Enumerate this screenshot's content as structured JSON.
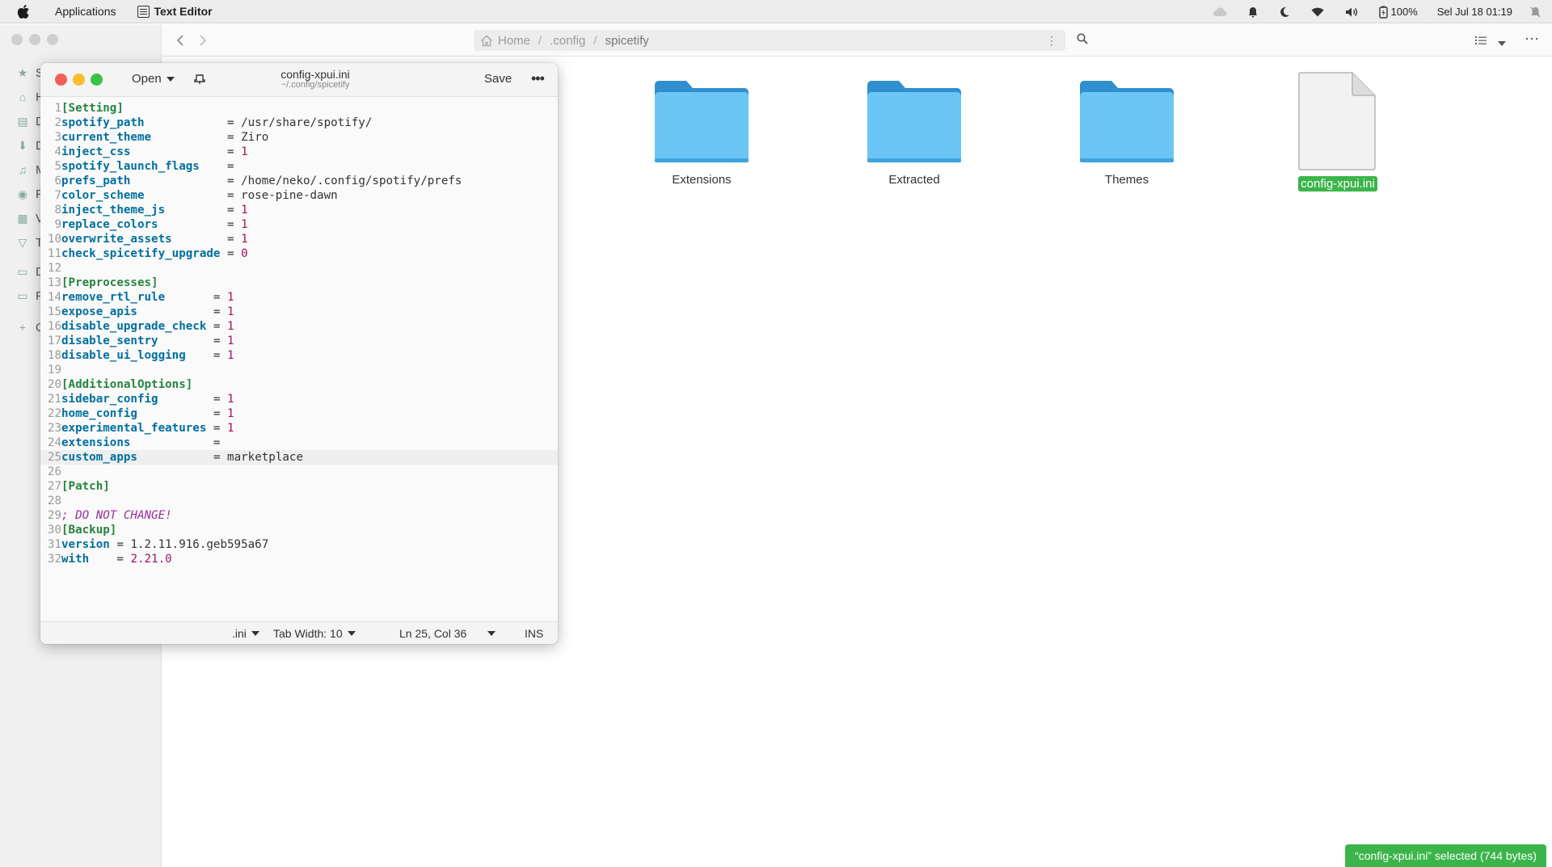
{
  "topbar": {
    "apple_icon": "apple-logo-icon",
    "applications": "Applications",
    "app_name": "Text Editor",
    "battery": "100%",
    "datetime": "Sel Jul 18  01:19"
  },
  "file_manager": {
    "path": {
      "home": "Home",
      "config": ".config",
      "current": "spicetify"
    },
    "sidebar_items": [
      {
        "label": "S",
        "icon": "star-icon"
      },
      {
        "label": "H",
        "icon": "home-icon"
      },
      {
        "label": "D",
        "icon": "documents-icon"
      },
      {
        "label": "D",
        "icon": "downloads-icon"
      },
      {
        "label": "M",
        "icon": "music-icon"
      },
      {
        "label": "P",
        "icon": "camera-icon"
      },
      {
        "label": "V",
        "icon": "video-icon"
      },
      {
        "label": "T",
        "icon": "trash-icon"
      },
      {
        "label": "D",
        "icon": "drive-icon"
      },
      {
        "label": "F",
        "icon": "folder-icon"
      },
      {
        "label": "O",
        "icon": "plus-icon"
      }
    ],
    "items": [
      {
        "name": "Extensions",
        "type": "folder",
        "selected": false
      },
      {
        "name": "Extracted",
        "type": "folder",
        "selected": false
      },
      {
        "name": "Themes",
        "type": "folder",
        "selected": false
      },
      {
        "name": "config-xpui.ini",
        "type": "file",
        "selected": true
      }
    ],
    "status": "“config-xpui.ini” selected  (744 bytes)"
  },
  "editor": {
    "open_label": "Open",
    "title": "config-xpui.ini",
    "subtitle": "~/.config/spicetify",
    "save_label": "Save",
    "footer": {
      "language": ".ini",
      "tab_width": "Tab Width: 10",
      "position": "Ln 25, Col 36",
      "mode": "INS"
    },
    "current_line": 25,
    "lines": [
      {
        "n": "1",
        "type": "section",
        "text": "[Setting]"
      },
      {
        "n": "2",
        "type": "kv",
        "key": "spotify_path",
        "pad": "            ",
        "value": "/usr/share/spotify/",
        "vtype": "str"
      },
      {
        "n": "3",
        "type": "kv",
        "key": "current_theme",
        "pad": "           ",
        "value": "Ziro",
        "vtype": "str"
      },
      {
        "n": "4",
        "type": "kv",
        "key": "inject_css",
        "pad": "              ",
        "value": "1",
        "vtype": "num"
      },
      {
        "n": "5",
        "type": "kv",
        "key": "spotify_launch_flags",
        "pad": "    ",
        "value": "",
        "vtype": "str"
      },
      {
        "n": "6",
        "type": "kv",
        "key": "prefs_path",
        "pad": "              ",
        "value": "/home/neko/.config/spotify/prefs",
        "vtype": "str"
      },
      {
        "n": "7",
        "type": "kv",
        "key": "color_scheme",
        "pad": "            ",
        "value": "rose-pine-dawn",
        "vtype": "str"
      },
      {
        "n": "8",
        "type": "kv",
        "key": "inject_theme_js",
        "pad": "         ",
        "value": "1",
        "vtype": "num"
      },
      {
        "n": "9",
        "type": "kv",
        "key": "replace_colors",
        "pad": "          ",
        "value": "1",
        "vtype": "num"
      },
      {
        "n": "10",
        "type": "kv",
        "key": "overwrite_assets",
        "pad": "        ",
        "value": "1",
        "vtype": "num"
      },
      {
        "n": "11",
        "type": "kv",
        "key": "check_spicetify_upgrade",
        "pad": " ",
        "value": "0",
        "vtype": "num"
      },
      {
        "n": "12",
        "type": "blank"
      },
      {
        "n": "13",
        "type": "section",
        "text": "[Preprocesses]"
      },
      {
        "n": "14",
        "type": "kv",
        "key": "remove_rtl_rule",
        "pad": "       ",
        "value": "1",
        "vtype": "num"
      },
      {
        "n": "15",
        "type": "kv",
        "key": "expose_apis",
        "pad": "           ",
        "value": "1",
        "vtype": "num"
      },
      {
        "n": "16",
        "type": "kv",
        "key": "disable_upgrade_check",
        "pad": " ",
        "value": "1",
        "vtype": "num"
      },
      {
        "n": "17",
        "type": "kv",
        "key": "disable_sentry",
        "pad": "        ",
        "value": "1",
        "vtype": "num"
      },
      {
        "n": "18",
        "type": "kv",
        "key": "disable_ui_logging",
        "pad": "    ",
        "value": "1",
        "vtype": "num"
      },
      {
        "n": "19",
        "type": "blank"
      },
      {
        "n": "20",
        "type": "section",
        "text": "[AdditionalOptions]"
      },
      {
        "n": "21",
        "type": "kv",
        "key": "sidebar_config",
        "pad": "        ",
        "value": "1",
        "vtype": "num"
      },
      {
        "n": "22",
        "type": "kv",
        "key": "home_config",
        "pad": "           ",
        "value": "1",
        "vtype": "num"
      },
      {
        "n": "23",
        "type": "kv",
        "key": "experimental_features",
        "pad": " ",
        "value": "1",
        "vtype": "num"
      },
      {
        "n": "24",
        "type": "kv",
        "key": "extensions",
        "pad": "            ",
        "value": "",
        "vtype": "str"
      },
      {
        "n": "25",
        "type": "kv",
        "key": "custom_apps",
        "pad": "           ",
        "value": "marketplace",
        "vtype": "str"
      },
      {
        "n": "26",
        "type": "blank"
      },
      {
        "n": "27",
        "type": "section",
        "text": "[Patch]"
      },
      {
        "n": "28",
        "type": "blank"
      },
      {
        "n": "29",
        "type": "comment",
        "text": "; DO NOT CHANGE!"
      },
      {
        "n": "30",
        "type": "section",
        "text": "[Backup]"
      },
      {
        "n": "31",
        "type": "kv",
        "key": "version",
        "pad": " ",
        "value": "1.2.11.916.geb595a67",
        "vtype": "str"
      },
      {
        "n": "32",
        "type": "kv",
        "key": "with",
        "pad": "    ",
        "value": "2.21.0",
        "vtype": "num"
      }
    ]
  },
  "colors": {
    "accent_green": "#3bb54a",
    "folder_blue": "#5bbcf0",
    "key_color": "#006fa0",
    "section_color": "#26843f",
    "number_color": "#a5125e"
  }
}
